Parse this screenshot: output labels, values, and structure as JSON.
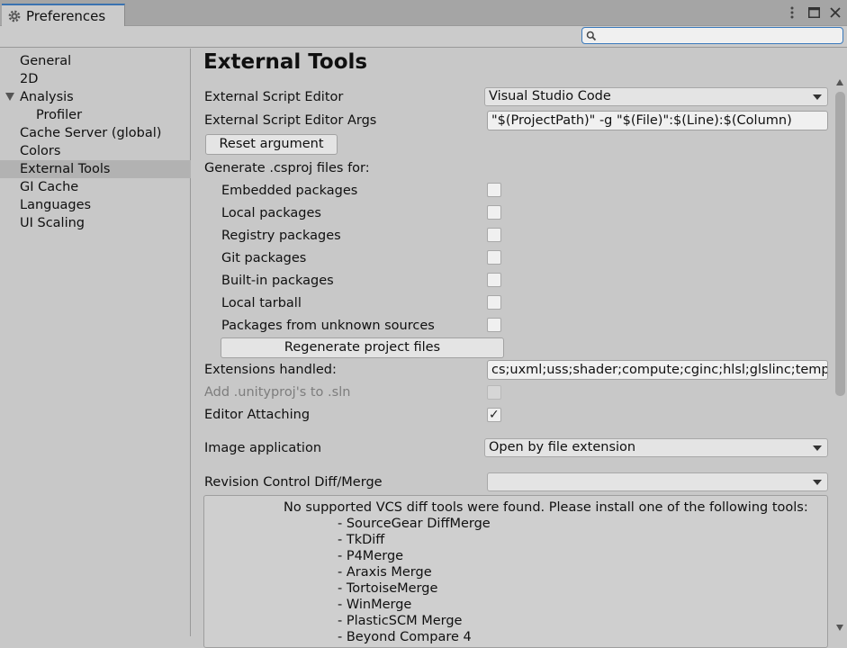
{
  "window": {
    "tab_title": "Preferences",
    "controls": {
      "menu_icon": "kebab-menu-icon",
      "maximize_icon": "maximize-icon",
      "close_icon": "close-icon"
    }
  },
  "search": {
    "value": "",
    "placeholder": "",
    "icon": "search-icon"
  },
  "sidebar": {
    "items": [
      {
        "label": "General"
      },
      {
        "label": "2D"
      },
      {
        "label": "Analysis"
      },
      {
        "label": "Profiler"
      },
      {
        "label": "Cache Server (global)"
      },
      {
        "label": "Colors"
      },
      {
        "label": "External Tools"
      },
      {
        "label": "GI Cache"
      },
      {
        "label": "Languages"
      },
      {
        "label": "UI Scaling"
      }
    ],
    "selected": "External Tools"
  },
  "main": {
    "title": "External Tools",
    "script_editor": {
      "label": "External Script Editor",
      "value": "Visual Studio Code"
    },
    "script_editor_args": {
      "label": "External Script Editor Args",
      "value": "\"$(ProjectPath)\" -g \"$(File)\":$(Line):$(Column)"
    },
    "reset_button": "Reset argument",
    "csproj_heading": "Generate .csproj files for:",
    "csproj_options": [
      {
        "label": "Embedded packages",
        "checked": false
      },
      {
        "label": "Local packages",
        "checked": false
      },
      {
        "label": "Registry packages",
        "checked": false
      },
      {
        "label": "Git packages",
        "checked": false
      },
      {
        "label": "Built-in packages",
        "checked": false
      },
      {
        "label": "Local tarball",
        "checked": false
      },
      {
        "label": "Packages from unknown sources",
        "checked": false
      }
    ],
    "regenerate_button": "Regenerate project files",
    "extensions": {
      "label": "Extensions handled:",
      "value": "cs;uxml;uss;shader;compute;cginc;hlsl;glslinc;templ"
    },
    "unityproj": {
      "label": "Add .unityproj's to .sln",
      "checked": false,
      "disabled": true
    },
    "editor_attaching": {
      "label": "Editor Attaching",
      "checked": true,
      "check_glyph": "✓"
    },
    "image_app": {
      "label": "Image application",
      "value": "Open by file extension"
    },
    "revision_control": {
      "label": "Revision Control Diff/Merge",
      "value": ""
    },
    "vcs_help": {
      "message": "No supported VCS diff tools were found. Please install one of the following tools:",
      "tools": [
        "- SourceGear DiffMerge",
        "- TkDiff",
        "- P4Merge",
        "- Araxis Merge",
        "- TortoiseMerge",
        "- WinMerge",
        "- PlasticSCM Merge",
        "- Beyond Compare 4"
      ]
    }
  }
}
